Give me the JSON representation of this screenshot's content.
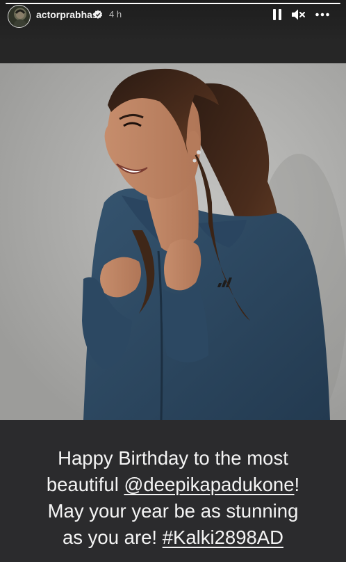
{
  "story": {
    "progress": 1.0,
    "author": {
      "username": "actorprabhas",
      "verified": true,
      "time": "4 h"
    },
    "controls": {
      "pause_icon": "pause-icon",
      "mute_icon": "speaker-muted-icon",
      "more_icon": "more-horizontal-icon"
    },
    "caption": {
      "line1": "Happy Birthday to the most",
      "line2_prefix": "beautiful ",
      "mention": "@deepikapadukone",
      "line2_suffix": "!",
      "line3": "May your year be as stunning",
      "line4_prefix": "as you are! ",
      "hashtag": "#Kalki2898AD"
    },
    "colors": {
      "background": "#262626",
      "caption_background": "#2b2b2d",
      "text": "#f4f4f4",
      "photo_backdrop": "#b0b0ae",
      "jacket": "#2f4a63"
    }
  }
}
